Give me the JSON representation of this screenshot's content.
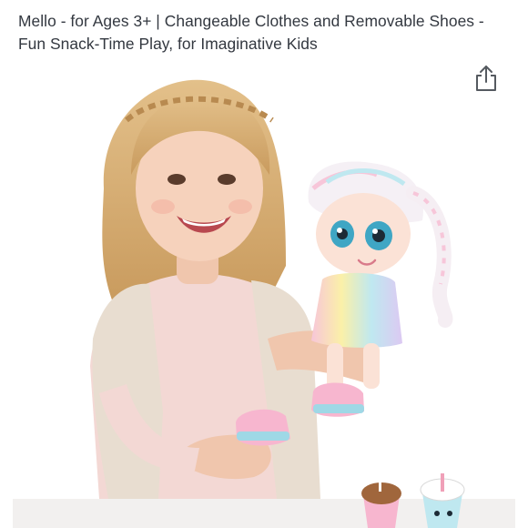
{
  "product": {
    "title_lines": [
      "Mello - for Ages 3+ | Changeable Clothes and Removable Shoes -",
      "Fun Snack-Time Play, for Imaginative Kids"
    ],
    "share_icon": "share-icon",
    "image_icon": "product-photo-girl-holding-doll"
  },
  "colors": {
    "text": "#333840",
    "icon": "#555a60",
    "background": "#ffffff"
  }
}
